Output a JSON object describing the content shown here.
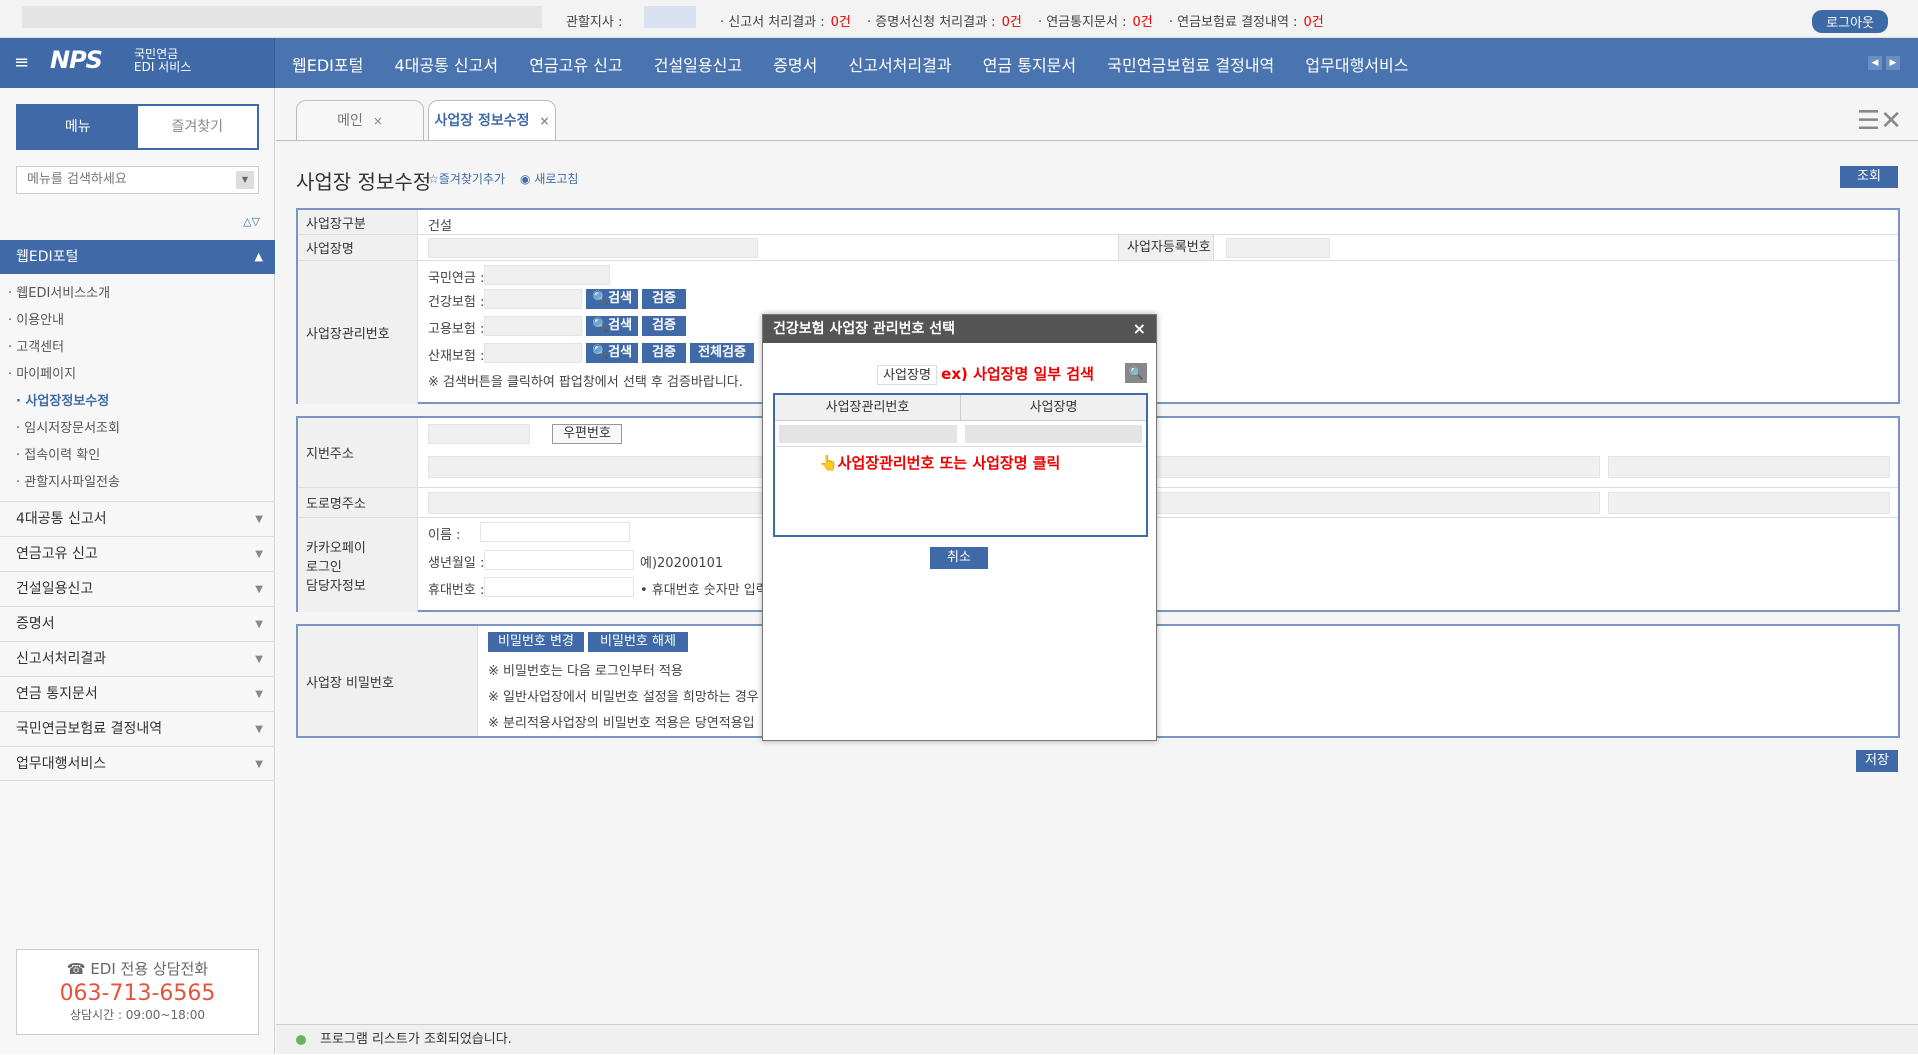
{
  "topbar": {
    "jurisdiction_label": "관할지사 :",
    "items": [
      {
        "label": "· 신고서 처리결과 :",
        "count": "0건"
      },
      {
        "label": "· 증명서신청 처리결과 :",
        "count": "0건"
      },
      {
        "label": "· 연금통지문서 :",
        "count": "0건"
      },
      {
        "label": "· 연금보험료 결정내역 :",
        "count": "0건"
      }
    ],
    "logout": "로그아웃"
  },
  "logo": {
    "main": "NPS",
    "line1": "국민연금",
    "line2": "EDI 서비스"
  },
  "nav": {
    "items": [
      "웹EDI포털",
      "4대공통 신고서",
      "연금고유 신고",
      "건설일용신고",
      "증명서",
      "신고서처리결과",
      "연금 통지문서",
      "국민연금보험료 결정내역",
      "업무대행서비스"
    ]
  },
  "sidebar": {
    "tab_menu": "메뉴",
    "tab_fav": "즐겨찾기",
    "search_placeholder": "메뉴를 검색하세요",
    "head": "웹EDI포털",
    "sub": [
      "· 웹EDI서비스소개",
      "· 이용안내",
      "· 고객센터",
      "· 마이페이지"
    ],
    "sub2": [
      "· 사업장정보수정",
      "· 임시저장문서조회",
      "· 접속이력 확인",
      "· 관할지사파일전송"
    ],
    "menus": [
      "4대공통 신고서",
      "연금고유 신고",
      "건설일용신고",
      "증명서",
      "신고서처리결과",
      "연금 통지문서",
      "국민연금보험료 결정내역",
      "업무대행서비스"
    ],
    "phone_title": "☎ EDI 전용 상담전화",
    "phone": "063-713-6565",
    "hours": "상담시간 : 09:00~18:00"
  },
  "content": {
    "tabs": [
      "메인",
      "사업장 정보수정"
    ],
    "title": "사업장 정보수정",
    "fav": "즐겨찾기추가",
    "refresh": "새로고침",
    "query_btn": "조회",
    "save_btn": "저장",
    "rows": {
      "type_label": "사업장구분",
      "type_val": "건설",
      "name_label": "사업장명",
      "biz_no_label": "사업자등록번호",
      "mgmt_label": "사업장관리번호",
      "pension": "국민연금 :",
      "health": "건강보험 :",
      "employ": "고용보험 :",
      "indust": "산재보험 :",
      "search_btn": "검색",
      "verify_btn": "검증",
      "verify_all": "전체검증",
      "notice": "※ 검색버튼을 클릭하여 팝업창에서 선택 후 검증바랍니다.",
      "jibun_label": "지번주소",
      "zip_btn": "우편번호",
      "road_label": "도로명주소",
      "kakao_label1": "카카오페이",
      "kakao_label2": "로그인",
      "kakao_label3": "담당자정보",
      "kname": "이름 :",
      "kbirth": "생년월일 :",
      "kbirth_ex": "예)20200101",
      "kphone": "휴대번호 :",
      "kphone_note": "• 휴대번호 숫자만 입력",
      "pw_label": "사업장 비밀번호",
      "pw_change": "비밀번호 변경",
      "pw_release": "비밀번호 해제",
      "pw_note1": "※ 비밀번호는 다음 로그인부터 적용",
      "pw_note2": "※ 일반사업장에서 비밀번호 설정을 희망하는 경우",
      "pw_note3": "※ 분리적용사업장의 비밀번호 적용은 당연적용입"
    },
    "status": "프로그램 리스트가 조회되었습니다."
  },
  "modal": {
    "title": "건강보험 사업장 관리번호 선택",
    "search_label": "사업장명",
    "hint_search": "ex) 사업장명 일부 검색",
    "col1": "사업장관리번호",
    "col2": "사업장명",
    "hint_click": "👆사업장관리번호 또는 사업장명 클릭",
    "cancel": "취소"
  }
}
